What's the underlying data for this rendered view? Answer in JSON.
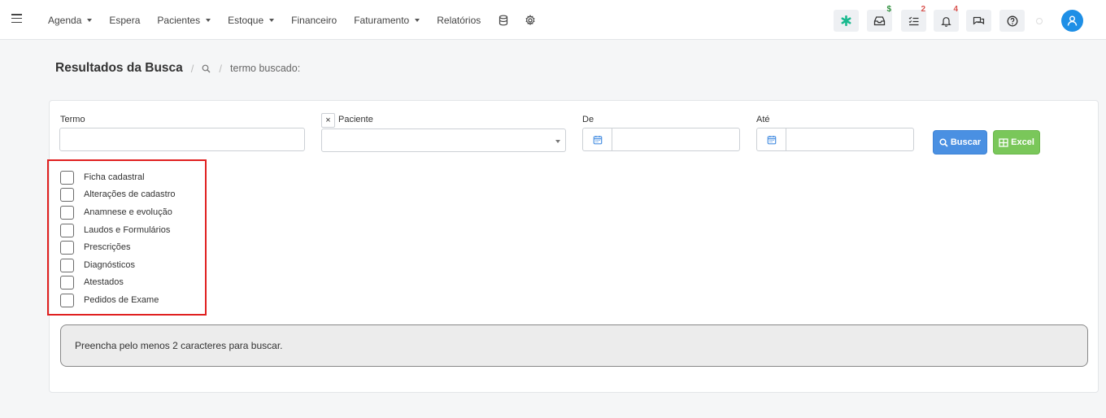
{
  "nav": {
    "items": [
      {
        "label": "Agenda",
        "dropdown": true
      },
      {
        "label": "Espera",
        "dropdown": false
      },
      {
        "label": "Pacientes",
        "dropdown": true
      },
      {
        "label": "Estoque",
        "dropdown": true
      },
      {
        "label": "Financeiro",
        "dropdown": false
      },
      {
        "label": "Faturamento",
        "dropdown": true
      },
      {
        "label": "Relatórios",
        "dropdown": false
      }
    ],
    "icons": [
      "database-icon",
      "gear-icon"
    ]
  },
  "toolbar": {
    "asterisk_color": "#19b98e",
    "inbox_badge": "$",
    "tasks_badge": "2",
    "notifications_badge": "4"
  },
  "breadcrumb": {
    "title": "Resultados da Busca",
    "search_term_label": "termo buscado:"
  },
  "form": {
    "termo_label": "Termo",
    "paciente_label": "Paciente",
    "paciente_clear": "×",
    "de_label": "De",
    "ate_label": "Até",
    "buscar_label": "Buscar",
    "excel_label": "Excel"
  },
  "checkboxes": [
    {
      "label": "Ficha cadastral",
      "checked": false
    },
    {
      "label": "Alterações de cadastro",
      "checked": false
    },
    {
      "label": "Anamnese e evolução",
      "checked": false
    },
    {
      "label": "Laudos e Formulários",
      "checked": false
    },
    {
      "label": "Prescrições",
      "checked": false
    },
    {
      "label": "Diagnósticos",
      "checked": false
    },
    {
      "label": "Atestados",
      "checked": false
    },
    {
      "label": "Pedidos de Exame",
      "checked": false
    }
  ],
  "alert": {
    "message": "Preencha pelo menos 2 caracteres para buscar."
  },
  "colors": {
    "primary": "#4a90e2",
    "success": "#7ac75a",
    "highlight": "#e02020",
    "avatar": "#1e8fe6"
  }
}
